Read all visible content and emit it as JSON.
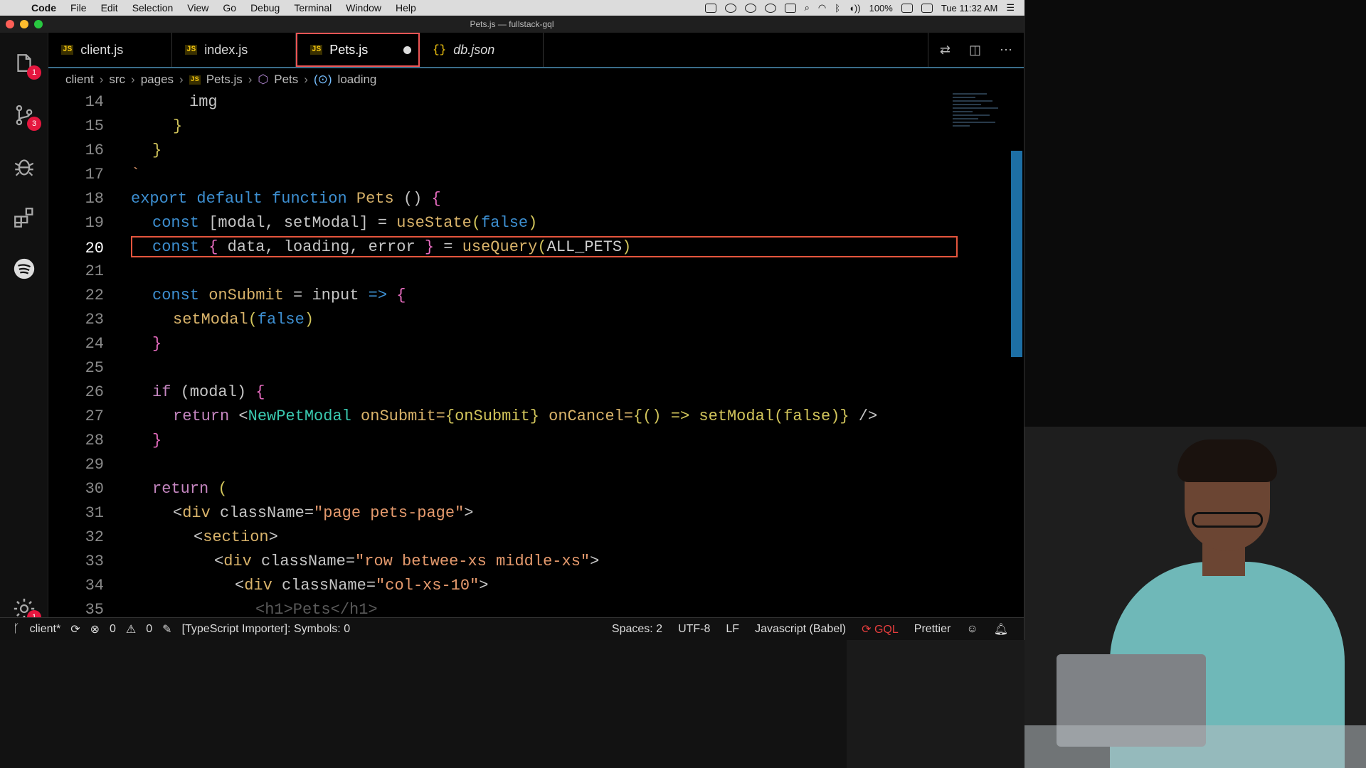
{
  "menubar": {
    "app": "Code",
    "items": [
      "File",
      "Edit",
      "Selection",
      "View",
      "Go",
      "Debug",
      "Terminal",
      "Window",
      "Help"
    ],
    "battery": "100%",
    "clock": "Tue 11:32 AM"
  },
  "window": {
    "title": "Pets.js — fullstack-gql"
  },
  "activity_bar": {
    "explorer_badge": "1",
    "scm_badge": "3",
    "settings_badge": "1"
  },
  "tabs": [
    {
      "label": "client.js",
      "type": "js"
    },
    {
      "label": "index.js",
      "type": "js"
    },
    {
      "label": "Pets.js",
      "type": "js",
      "active": true,
      "dirty": true
    },
    {
      "label": "db.json",
      "type": "json"
    }
  ],
  "breadcrumb": {
    "parts": [
      "client",
      "src",
      "pages"
    ],
    "file": "Pets.js",
    "component": "Pets",
    "symbol": "loading"
  },
  "editor": {
    "current_line": "20",
    "line_numbers": [
      "14",
      "15",
      "16",
      "17",
      "18",
      "19",
      "20",
      "21",
      "22",
      "23",
      "24",
      "25",
      "26",
      "27",
      "28",
      "29",
      "30",
      "31",
      "32",
      "33",
      "34",
      "35"
    ]
  },
  "code_tokens": {
    "l14": "img",
    "l15": "}",
    "l16": "}",
    "l17": "`",
    "l18_kw1": "export",
    "l18_kw2": "default",
    "l18_kw3": "function",
    "l18_name": "Pets",
    "l18_rest": " () ",
    "l18_brace": "{",
    "l19_kw": "const",
    "l19_body": " [modal, setModal] = ",
    "l19_fn": "useState",
    "l19_arg": "false",
    "l20_kw": "const",
    "l20_open": "{",
    "l20_body": " data, loading, error ",
    "l20_close": "}",
    "l20_eq": " = ",
    "l20_fn": "useQuery",
    "l20_arg": "ALL_PETS",
    "l22_kw": "const",
    "l22_name": "onSubmit",
    "l22_mid": " = input ",
    "l22_arrow": "=>",
    "l22_brace": "{",
    "l23_fn": "setModal",
    "l23_arg": "false",
    "l24": "}",
    "l26_kw": "if",
    "l26_cond": " (modal) ",
    "l26_brace": "{",
    "l27_kw": "return",
    "l27_tag": "NewPetModal",
    "l27_attr1": " onSubmit=",
    "l27_val1": "{onSubmit}",
    "l27_attr2": " onCancel=",
    "l27_val2": "{() => setModal(false)}",
    "l27_end": " />",
    "l28": "}",
    "l30_kw": "return",
    "l30_paren": " (",
    "l31_tag": "div",
    "l31_attr": " className=",
    "l31_val": "\"page pets-page\"",
    "l32_tag": "section",
    "l33_tag": "div",
    "l33_attr": " className=",
    "l33_val": "\"row betwee-xs middle-xs\"",
    "l34_tag": "div",
    "l34_attr": " className=",
    "l34_val": "\"col-xs-10\"",
    "l35": "<h1>Pets</h1>"
  },
  "statusbar": {
    "branch": "client*",
    "errors": "0",
    "warnings": "0",
    "message": "[TypeScript Importer]: Symbols: 0",
    "spaces": "Spaces: 2",
    "encoding": "UTF-8",
    "eol": "LF",
    "language": "Javascript (Babel)",
    "gql": "GQL",
    "formatter": "Prettier"
  },
  "colors": {
    "accent": "#1d6fa5",
    "current_line_border": "#e4553d",
    "badge": "#e5173f"
  }
}
